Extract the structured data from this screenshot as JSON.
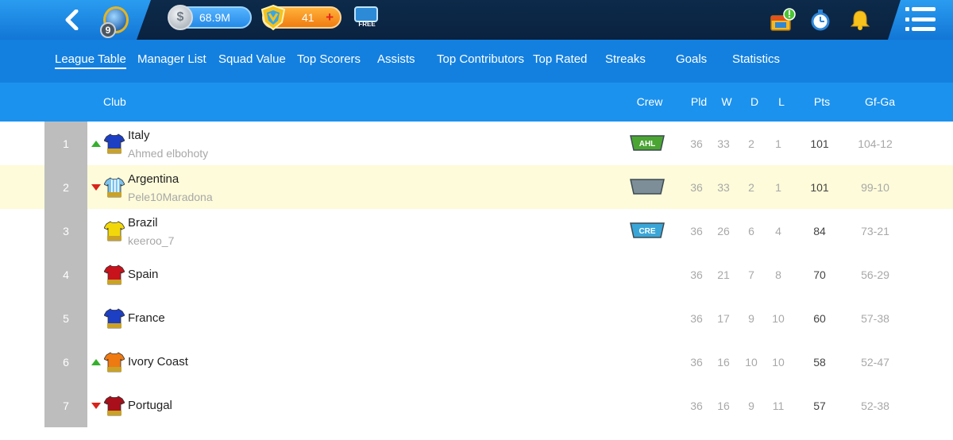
{
  "topbar": {
    "level": "9",
    "coins": "68.9M",
    "tokens": "41",
    "free_label": "FREE",
    "icons": [
      "gsm-shop-icon",
      "stopwatch-icon",
      "bell-icon",
      "menu-icon"
    ]
  },
  "tabs": [
    {
      "label": "League Table",
      "active": true
    },
    {
      "label": "Manager List"
    },
    {
      "label": "Squad Value"
    },
    {
      "label": "Top Scorers"
    },
    {
      "label": "Assists"
    },
    {
      "label": "Top Contributors"
    },
    {
      "label": "Top Rated"
    },
    {
      "label": "Streaks"
    },
    {
      "label": "Goals"
    },
    {
      "label": "Statistics"
    }
  ],
  "table": {
    "headers": {
      "club": "Club",
      "crew": "Crew",
      "pld": "Pld",
      "w": "W",
      "d": "D",
      "l": "L",
      "pts": "Pts",
      "gfga": "Gf-Ga"
    },
    "rows": [
      {
        "rank": "1",
        "move": "up",
        "team": "Italy",
        "manager": "Ahmed elbohoty",
        "crew": "AHL",
        "crew_color": "green",
        "kit": "blue",
        "pld": "36",
        "w": "33",
        "d": "2",
        "l": "1",
        "pts": "101",
        "gfga": "104-12"
      },
      {
        "rank": "2",
        "move": "down",
        "team": "Argentina",
        "manager": "Pele10Maradona",
        "crew": "",
        "crew_color": "grey",
        "kit": "stripes",
        "pld": "36",
        "w": "33",
        "d": "2",
        "l": "1",
        "pts": "101",
        "gfga": "99-10"
      },
      {
        "rank": "3",
        "move": "",
        "team": "Brazil",
        "manager": "keeroo_7",
        "crew": "CRE",
        "crew_color": "blue",
        "kit": "yellow",
        "pld": "36",
        "w": "26",
        "d": "6",
        "l": "4",
        "pts": "84",
        "gfga": "73-21"
      },
      {
        "rank": "4",
        "move": "",
        "team": "Spain",
        "manager": "",
        "crew": null,
        "kit": "red",
        "pld": "36",
        "w": "21",
        "d": "7",
        "l": "8",
        "pts": "70",
        "gfga": "56-29"
      },
      {
        "rank": "5",
        "move": "",
        "team": "France",
        "manager": "",
        "crew": null,
        "kit": "blue",
        "pld": "36",
        "w": "17",
        "d": "9",
        "l": "10",
        "pts": "60",
        "gfga": "57-38"
      },
      {
        "rank": "6",
        "move": "up",
        "team": "Ivory Coast",
        "manager": "",
        "crew": null,
        "kit": "orange",
        "pld": "36",
        "w": "16",
        "d": "10",
        "l": "10",
        "pts": "58",
        "gfga": "52-47"
      },
      {
        "rank": "7",
        "move": "down",
        "team": "Portugal",
        "manager": "",
        "crew": null,
        "kit": "darkred",
        "pld": "36",
        "w": "16",
        "d": "9",
        "l": "11",
        "pts": "57",
        "gfga": "52-38"
      }
    ]
  },
  "colors": {
    "kit_colors": {
      "blue": "#1d3fc4",
      "stripes": "#7cc3ee",
      "yellow": "#f2d80b",
      "red": "#c8121c",
      "orange": "#ef7a12",
      "darkred": "#a80f1a"
    },
    "crew_colors": {
      "green": "#4aa532",
      "grey": "#7d8e98",
      "blue": "#3aa6d8"
    },
    "move_up": "#35b02d",
    "move_down": "#d9231b"
  }
}
